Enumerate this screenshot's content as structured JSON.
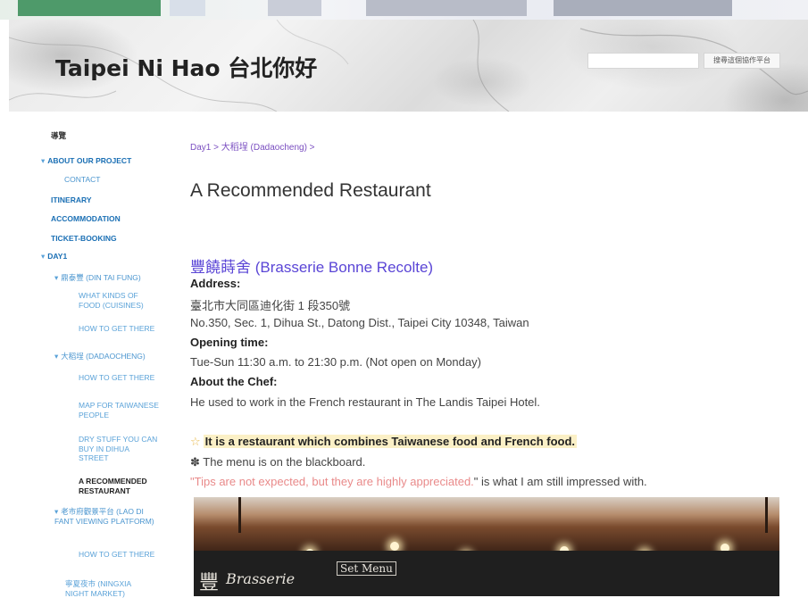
{
  "header": {
    "site_title": "Taipei Ni Hao 台北你好",
    "search_placeholder": "",
    "search_button": "搜尋這個協作平台"
  },
  "sidebar": {
    "items": [
      {
        "label": "導覽"
      },
      {
        "label": "ABOUT OUR PROJECT"
      },
      {
        "label": "CONTACT"
      },
      {
        "label": "ITINERARY"
      },
      {
        "label": "ACCOMMODATION"
      },
      {
        "label": "TICKET-BOOKING"
      },
      {
        "label": "DAY1"
      },
      {
        "label": "鼎泰豐 (DIN TAI FUNG)"
      },
      {
        "label": "WHAT KINDS OF FOOD (CUISINES)"
      },
      {
        "label": "HOW TO GET THERE"
      },
      {
        "label": "大稻埕 (DADAOCHENG)"
      },
      {
        "label": "HOW TO GET THERE"
      },
      {
        "label": "MAP FOR TAIWANESE PEOPLE"
      },
      {
        "label": "DRY STUFF YOU CAN BUY IN DIHUA STREET"
      },
      {
        "label": "A RECOMMENDED RESTAURANT"
      },
      {
        "label": "老市府觀景平台 (LAO DI FANT VIEWING PLATFORM)"
      },
      {
        "label": "HOW TO GET THERE"
      },
      {
        "label": "寧夏夜市 (NINGXIA NIGHT MARKET)"
      }
    ]
  },
  "main": {
    "breadcrumb": "Day1 > 大稻埕 (Dadaocheng) >",
    "title": "A Recommended Restaurant",
    "restaurant_name": "豐饒蒔舍 (Brasserie Bonne Recolte)",
    "address_label": "Address",
    "address_zh": "臺北市大同區迪化街 1 段350號",
    "address_en": "No.350, Sec. 1, Dihua St., Datong Dist., Taipei City 10348, Taiwan",
    "opening_label": "Opening time",
    "opening_hours": "Tue-Sun  11:30 a.m. to 21:30 p.m. (Not open on Monday)",
    "chef_label": "About the Chef:",
    "chef_text": "He used to work in the French restaurant in The Landis Taipei Hotel.",
    "star": "☆",
    "highlight": "It is a restaurant which combines Taiwanese food and French food.",
    "menu_note": "✽ The menu is on the blackboard.",
    "quote_open": "\"",
    "quote_pink": "Tips are not expected, but they are highly appreciated.",
    "quote_rest": "\" is what I am still impressed with.",
    "photo": {
      "chalk_zh": "豐",
      "chalk_brand": "Brasserie",
      "chalk_menu": "Set Menu"
    }
  }
}
